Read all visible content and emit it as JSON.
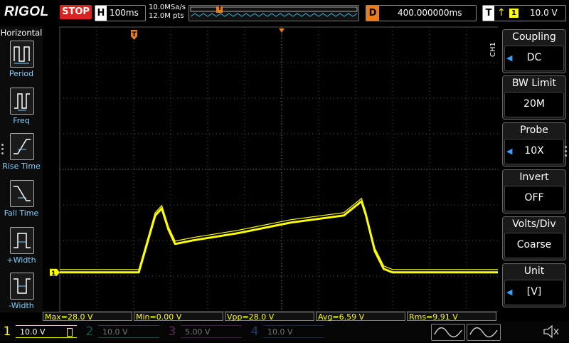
{
  "brand": "RIGOL",
  "run_state": "STOP",
  "timebase": {
    "label": "H",
    "value": "100ms"
  },
  "sample_rate": "10.0MSa/s",
  "memory_depth": "12.0M pts",
  "delay": {
    "label": "D",
    "value": "400.000000ms"
  },
  "trigger": {
    "label": "T",
    "edge": "rising",
    "source": "1",
    "level": "10.0 V",
    "marker": "T"
  },
  "left_menu": {
    "title": "Horizontal",
    "items": [
      {
        "label": "Period",
        "icon": "period-icon"
      },
      {
        "label": "Freq",
        "icon": "frequency-icon"
      },
      {
        "label": "Rise Time",
        "icon": "rise-time-icon"
      },
      {
        "label": "Fall Time",
        "icon": "fall-time-icon"
      },
      {
        "label": "+Width",
        "icon": "positive-width-icon"
      },
      {
        "label": "-Width",
        "icon": "negative-width-icon"
      }
    ]
  },
  "right_menu": {
    "channel_tag": "CH1",
    "items": [
      {
        "title": "Coupling",
        "value": "DC",
        "has_arrow": true
      },
      {
        "title": "BW Limit",
        "value": "20M",
        "has_arrow": false
      },
      {
        "title": "Probe",
        "value": "10X",
        "has_arrow": true
      },
      {
        "title": "Invert",
        "value": "OFF",
        "has_arrow": false
      },
      {
        "title": "Volts/Div",
        "value": "Coarse",
        "has_arrow": false
      },
      {
        "title": "Unit",
        "value": "[V]",
        "has_arrow": true
      }
    ]
  },
  "measurements": [
    {
      "label": "Max=28.0 V"
    },
    {
      "label": "Min=0.00 V"
    },
    {
      "label": "Vpp=28.0 V"
    },
    {
      "label": "Avg=6.59 V"
    },
    {
      "label": "Rms=9.91 V"
    }
  ],
  "channels": [
    {
      "num": "1",
      "scale": "10.0 V",
      "active": true,
      "color": "#ffff00"
    },
    {
      "num": "2",
      "scale": "10.0 V",
      "active": false,
      "color": "#2aa6a6"
    },
    {
      "num": "3",
      "scale": "5.00 V",
      "active": false,
      "color": "#c040c0"
    },
    {
      "num": "4",
      "scale": "10.0 V",
      "active": false,
      "color": "#3a6fd8"
    }
  ],
  "ch1_marker": "1",
  "colors": {
    "trace": "#ffff00",
    "trigger": "#e87c1e",
    "grid": "#555555",
    "stop": "#d8231f",
    "menu_accent": "#3aa0ff"
  },
  "waveform": {
    "time_ms": [
      0,
      178,
      215,
      230,
      245,
      260,
      300,
      400,
      520,
      640,
      680,
      690,
      710,
      730,
      750,
      850,
      960,
      1000
    ],
    "volts": [
      0,
      0,
      16,
      18,
      12,
      8,
      9,
      11,
      14,
      16,
      20,
      16,
      6,
      1,
      0,
      0,
      0,
      0
    ],
    "t_range_ms": [
      0,
      1000
    ],
    "v_per_div": 10,
    "divisions_v": 8
  }
}
